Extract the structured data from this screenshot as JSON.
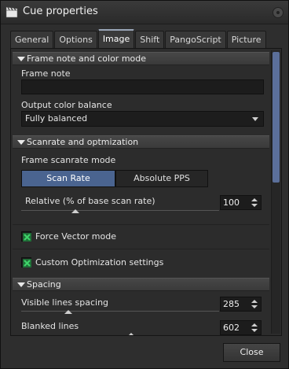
{
  "window": {
    "title": "Cue properties",
    "icon": "clapperboard-icon"
  },
  "tabs": [
    {
      "label": "General",
      "active": false
    },
    {
      "label": "Options",
      "active": false
    },
    {
      "label": "Image",
      "active": true
    },
    {
      "label": "Shift",
      "active": false
    },
    {
      "label": "PangoScript",
      "active": false
    },
    {
      "label": "Picture",
      "active": false
    }
  ],
  "sections": {
    "frame_note": {
      "header": "Frame note and color mode",
      "note_label": "Frame note",
      "note_value": "",
      "balance_label": "Output color balance",
      "balance_value": "Fully balanced"
    },
    "scanrate": {
      "header": "Scanrate and optmization",
      "mode_label": "Frame scanrate mode",
      "mode_options": [
        "Scan Rate",
        "Absolute PPS"
      ],
      "selected_mode": "Scan Rate",
      "relative_label": "Relative (% of base scan rate)",
      "relative_value": "100",
      "force_vector_label": "Force Vector mode",
      "force_vector_checked": true,
      "custom_opt_label": "Custom Optimization settings",
      "custom_opt_checked": true
    },
    "spacing": {
      "header": "Spacing",
      "visible_label": "Visible lines spacing",
      "visible_value": "285",
      "blanked_label": "Blanked lines",
      "blanked_value": "602"
    }
  },
  "footer": {
    "close_label": "Close"
  },
  "colors": {
    "accent": "#4a6490",
    "check": "#2fa84f",
    "scroll_thumb": "#5b6f9a"
  }
}
